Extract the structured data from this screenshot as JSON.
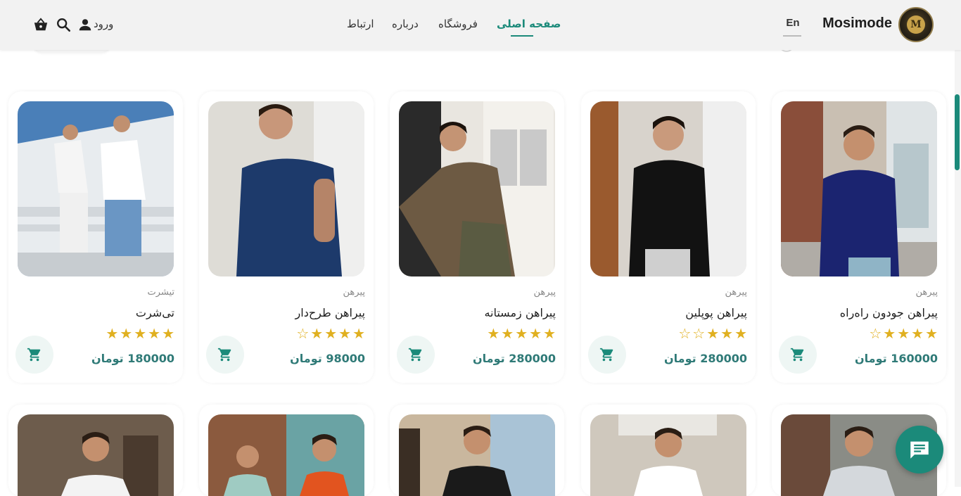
{
  "header": {
    "brand": "Mosimode",
    "lang": "En",
    "nav": [
      {
        "label": "صفحه اصلی",
        "active": true
      },
      {
        "label": "فروشگاه",
        "active": false
      },
      {
        "label": "درباره",
        "active": false
      },
      {
        "label": "ارتباط",
        "active": false
      }
    ],
    "login_label": "ورود",
    "icons": [
      "user-icon",
      "search-icon",
      "basket-icon"
    ]
  },
  "products": [
    {
      "category": "پیرهن",
      "name": "پیراهن جودون راه‌راه",
      "rating": 4,
      "price": "160000 تومان"
    },
    {
      "category": "پیرهن",
      "name": "پیراهن پوپلین",
      "rating": 3,
      "price": "280000 تومان"
    },
    {
      "category": "پیرهن",
      "name": "پیراهن زمستانه",
      "rating": 5,
      "price": "280000 تومان"
    },
    {
      "category": "پیرهن",
      "name": "پیراهن طرح‌دار",
      "rating": 4,
      "price": "98000 تومان"
    },
    {
      "category": "تیشرت",
      "name": "تی‌شرت",
      "rating": 5,
      "price": "180000 تومان"
    }
  ],
  "colors": {
    "accent": "#1b8a7a",
    "price": "#2f7a77",
    "star": "#e0b020",
    "header_bg": "#f2f2f2"
  }
}
